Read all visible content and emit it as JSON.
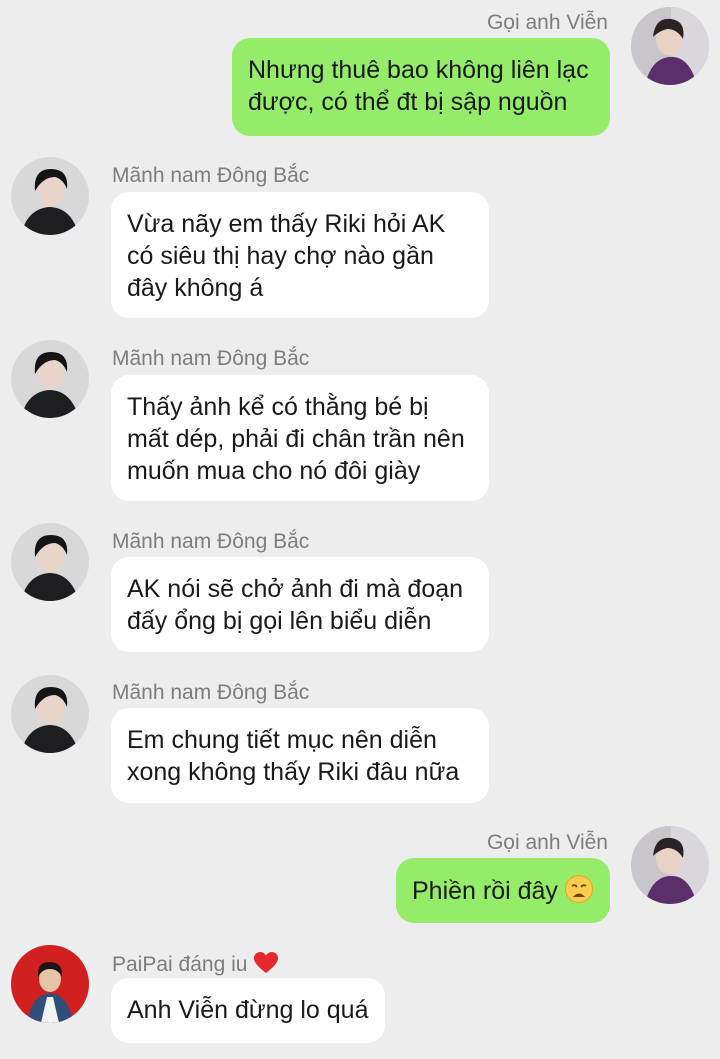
{
  "messages": [
    {
      "sender": "Gọi anh Viễn",
      "lines": [
        "Nhưng thuê bao không liên lạc",
        "được, có thể đt bị sập nguồn"
      ]
    },
    {
      "sender": "Mãnh nam Đông Bắc",
      "lines": [
        "Vừa nãy em thấy Riki hỏi AK",
        "có siêu thị hay chợ nào gần",
        "đây không á"
      ]
    },
    {
      "sender": "Mãnh nam Đông Bắc",
      "lines": [
        "Thấy ảnh kể có thằng bé bị",
        "mất dép, phải đi chân trần nên",
        "muốn mua cho nó đôi giày"
      ]
    },
    {
      "sender": "Mãnh nam Đông Bắc",
      "lines": [
        "AK nói sẽ chở ảnh đi mà đoạn",
        "đấy ổng bị gọi lên biểu diễn"
      ]
    },
    {
      "sender": "Mãnh nam Đông Bắc",
      "lines": [
        "Em chung tiết mục nên diễn",
        "xong không thấy Riki đâu nữa"
      ]
    },
    {
      "sender": "Gọi anh Viễn",
      "lines": [
        "Phiền rồi đây"
      ],
      "emoji": "weary-face-icon"
    },
    {
      "sender": "PaiPai đáng iu",
      "sender_emoji": "red-heart-icon",
      "lines": [
        "Anh Viễn đừng lo quá"
      ]
    }
  ],
  "colors": {
    "background": "#ededed",
    "outgoing_bubble": "#95ec69",
    "incoming_bubble": "#ffffff",
    "name_text": "#7d7d7d"
  }
}
